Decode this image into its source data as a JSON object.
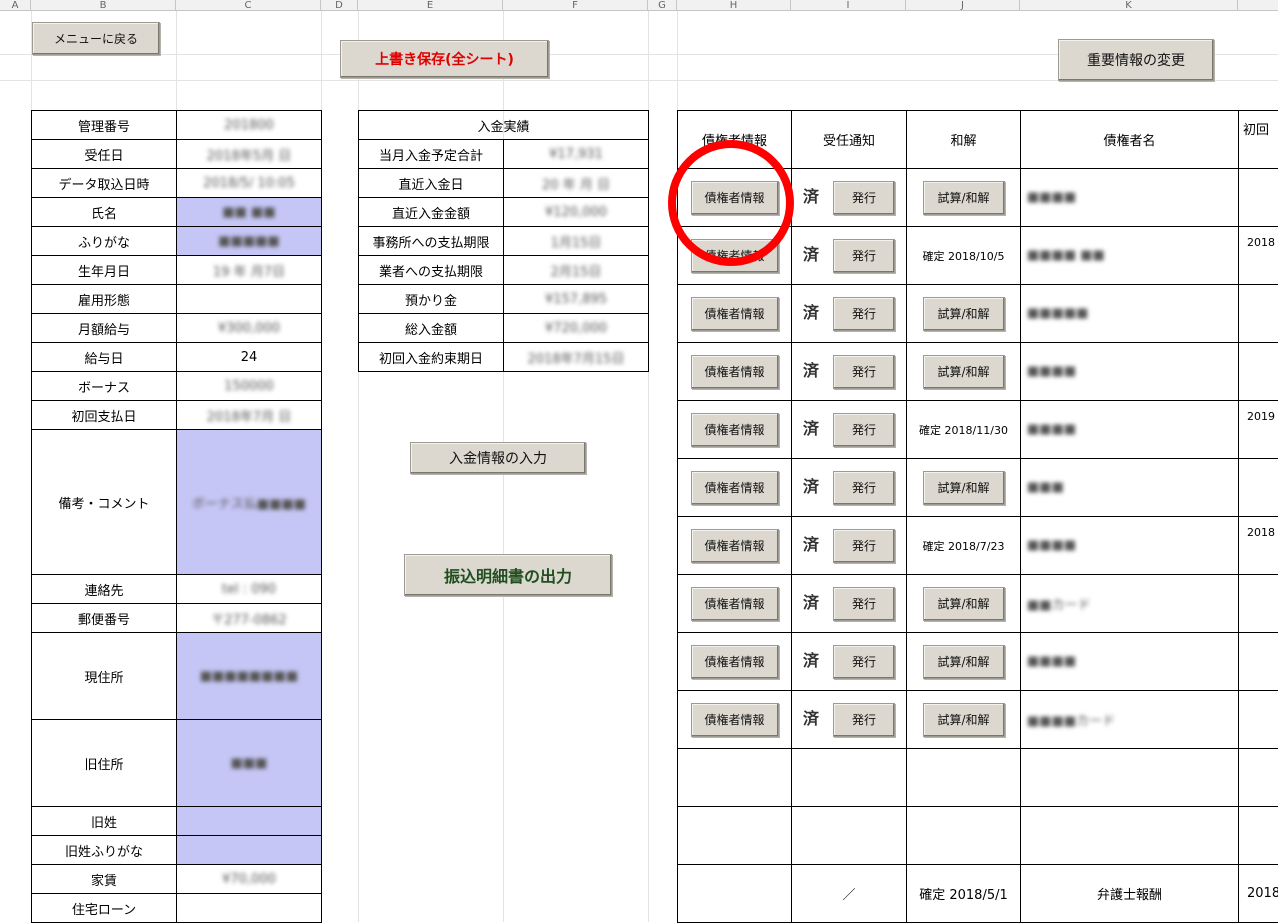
{
  "columns": [
    "A",
    "B",
    "C",
    "D",
    "E",
    "F",
    "G",
    "H",
    "I",
    "J",
    "K"
  ],
  "buttons": {
    "menu": "メニューに戻る",
    "save_all": "上書き保存(全シート)",
    "important_change": "重要情報の変更",
    "payment_input": "入金情報の入力",
    "transfer_output": "振込明細書の出力"
  },
  "left_table": [
    {
      "label": "管理番号",
      "value": "201800"
    },
    {
      "label": "受任日",
      "value": "2018年5月 日"
    },
    {
      "label": "データ取込日時",
      "value": "2018/5/ 10:05"
    },
    {
      "label": "氏名",
      "value": "■■ ■■"
    },
    {
      "label": "ふりがな",
      "value": "■■■■■"
    },
    {
      "label": "生年月日",
      "value": "19  年 月7日"
    },
    {
      "label": "雇用形態",
      "value": ""
    },
    {
      "label": "月額給与",
      "value": "¥300,000"
    },
    {
      "label": "給与日",
      "value": "24"
    },
    {
      "label": "ボーナス",
      "value": "150000"
    },
    {
      "label": "初回支払日",
      "value": "2018年7月 日"
    },
    {
      "label": "備考・コメント",
      "value": "ボーナス払■■■■"
    },
    {
      "label": "連絡先",
      "value": "tel : 090"
    },
    {
      "label": "郵便番号",
      "value": "〒277-0862"
    },
    {
      "label": "現住所",
      "value": "■■■■■■■■"
    },
    {
      "label": "旧住所",
      "value": "■■■"
    },
    {
      "label": "旧姓",
      "value": ""
    },
    {
      "label": "旧姓ふりがな",
      "value": ""
    },
    {
      "label": "家賃",
      "value": "¥70,000"
    },
    {
      "label": "住宅ローン",
      "value": ""
    }
  ],
  "payments": {
    "title": "入金実績",
    "rows": [
      {
        "label": "当月入金予定合計",
        "value": "¥17,931"
      },
      {
        "label": "直近入金日",
        "value": "20  年 月 日"
      },
      {
        "label": "直近入金金額",
        "value": "¥120,000"
      },
      {
        "label": "事務所への支払期限",
        "value": "1月15日"
      },
      {
        "label": "業者への支払期限",
        "value": "2月15日"
      },
      {
        "label": "預かり金",
        "value": "¥157,895"
      },
      {
        "label": "総入金額",
        "value": "¥720,000"
      },
      {
        "label": "初回入金約束期日",
        "value": "2018年7月15日"
      }
    ]
  },
  "creditors": {
    "headers": [
      "債権者情報",
      "受任通知",
      "和解",
      "債権者名",
      "初回"
    ],
    "info_button": "債権者情報",
    "notice_status": "済",
    "issue_button": "発行",
    "settle_button": "試算/和解",
    "rows": [
      {
        "wakai_type": "button",
        "wakai_text": "",
        "name": "■■■■",
        "initial": ""
      },
      {
        "wakai_type": "text",
        "wakai_text": "確定 2018/10/5",
        "name": "■■■■ ■■",
        "initial": "2018"
      },
      {
        "wakai_type": "button",
        "wakai_text": "",
        "name": "■■■■■",
        "initial": ""
      },
      {
        "wakai_type": "button",
        "wakai_text": "",
        "name": "■■■■",
        "initial": ""
      },
      {
        "wakai_type": "text",
        "wakai_text": "確定 2018/11/30",
        "name": "■■■■",
        "initial": "2019"
      },
      {
        "wakai_type": "button",
        "wakai_text": "",
        "name": "■■■",
        "initial": ""
      },
      {
        "wakai_type": "text",
        "wakai_text": "確定 2018/7/23",
        "name": "■■■■",
        "initial": "2018"
      },
      {
        "wakai_type": "button",
        "wakai_text": "",
        "name": "■■カード",
        "initial": ""
      },
      {
        "wakai_type": "button",
        "wakai_text": "",
        "name": "■■■■",
        "initial": ""
      },
      {
        "wakai_type": "button",
        "wakai_text": "",
        "name": "■■■■カード",
        "initial": ""
      }
    ],
    "last_row": {
      "notice": "／",
      "wakai": "確定 2018/5/1",
      "name": "弁護士報酬",
      "initial": "2018"
    }
  }
}
